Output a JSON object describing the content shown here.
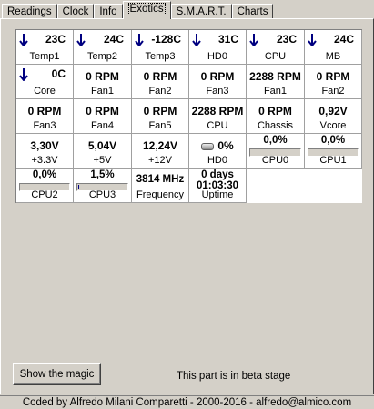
{
  "tabs": [
    {
      "label": "Readings"
    },
    {
      "label": "Clock"
    },
    {
      "label": "Info"
    },
    {
      "label": "Exotics",
      "active": true
    },
    {
      "label": "S.M.A.R.T."
    },
    {
      "label": "Charts"
    }
  ],
  "accent_color": "#000080",
  "rows": [
    [
      {
        "value": "23C",
        "label": "Temp1",
        "arrow": "down-arrow-icon"
      },
      {
        "value": "24C",
        "label": "Temp2",
        "arrow": "down-arrow-icon"
      },
      {
        "value": "-128C",
        "label": "Temp3",
        "arrow": "down-arrow-icon"
      },
      {
        "value": "31C",
        "label": "HD0",
        "arrow": "down-arrow-icon"
      },
      {
        "value": "23C",
        "label": "CPU",
        "arrow": "down-arrow-icon"
      },
      {
        "value": "24C",
        "label": "MB",
        "arrow": "down-arrow-icon"
      }
    ],
    [
      {
        "value": "0C",
        "label": "Core",
        "arrow": "down-arrow-icon"
      },
      {
        "value": "0 RPM",
        "label": "Fan1"
      },
      {
        "value": "0 RPM",
        "label": "Fan2"
      },
      {
        "value": "0 RPM",
        "label": "Fan3"
      },
      {
        "value": "2288 RPM",
        "label": "Fan1"
      },
      {
        "value": "0 RPM",
        "label": "Fan2"
      }
    ],
    [
      {
        "value": "0 RPM",
        "label": "Fan3"
      },
      {
        "value": "0 RPM",
        "label": "Fan4"
      },
      {
        "value": "0 RPM",
        "label": "Fan5"
      },
      {
        "value": "2288 RPM",
        "label": "CPU"
      },
      {
        "value": "0 RPM",
        "label": "Chassis"
      },
      {
        "value": "0,92V",
        "label": "Vcore"
      }
    ],
    [
      {
        "value": "3,30V",
        "label": "+3.3V"
      },
      {
        "value": "5,04V",
        "label": "+5V"
      },
      {
        "value": "12,24V",
        "label": "+12V"
      },
      {
        "value": "0%",
        "label": "HD0",
        "toggle": true
      },
      {
        "value": "0,0%",
        "label": "CPU0",
        "bar": 0.0
      },
      {
        "value": "0,0%",
        "label": "CPU1",
        "bar": 0.0
      }
    ],
    [
      {
        "value": "0,0%",
        "label": "CPU2",
        "bar": 0.0
      },
      {
        "value": "1,5%",
        "label": "CPU3",
        "bar": 0.015
      },
      {
        "value": "3814 MHz",
        "label": "Frequency"
      },
      {
        "value": "0 days",
        "value2": "01:03:30",
        "label": "Uptime"
      }
    ]
  ],
  "magic_button": "Show the magic",
  "beta_text": "This part is in beta stage",
  "footer": "Coded by Alfredo Milani Comparetti - 2000-2016 - alfredo@almico.com"
}
